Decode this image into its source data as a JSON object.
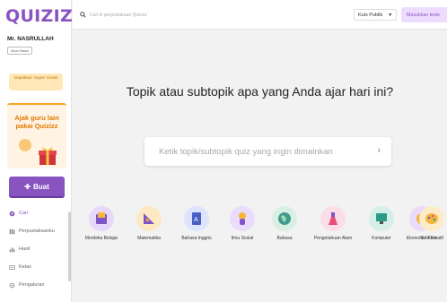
{
  "brand": {
    "logo": "QUIZIZZ"
  },
  "user": {
    "name": "Mr. NASRULLAH",
    "account_badge": "Akun Basic"
  },
  "sidebar": {
    "super_button": "Dapatkan Super Gratis",
    "promo_text": "Ajak guru lain pakai Quizizz",
    "create_label": "Buat",
    "nav": [
      {
        "label": "Cari",
        "icon": "compass-icon"
      },
      {
        "label": "Perpustakaanku",
        "icon": "library-icon"
      },
      {
        "label": "Hasil",
        "icon": "chart-icon"
      },
      {
        "label": "Kelas",
        "icon": "class-icon"
      },
      {
        "label": "Pengaturan",
        "icon": "gear-icon"
      }
    ]
  },
  "topbar": {
    "search_placeholder": "Cari di perpustakaan Quizizz",
    "filter_value": "Kuis Publik",
    "join_label": "Masukkan kode"
  },
  "main": {
    "headline": "Topik atau subtopik apa yang Anda ajar hari ini?",
    "topic_placeholder": "Ketik topik/subtopik quiz yang ingin dimainkan",
    "subjects": [
      {
        "label": "Merdeka Belajar",
        "color": "#f3e5ff"
      },
      {
        "label": "Matematika",
        "color": "#fff0d6"
      },
      {
        "label": "Bahasa Inggris",
        "color": "#e6ecff"
      },
      {
        "label": "Ilmu Sosial",
        "color": "#efe4ff"
      },
      {
        "label": "Bahasa",
        "color": "#e0f3ea"
      },
      {
        "label": "Pengetahuan Alam",
        "color": "#ffe4ee"
      },
      {
        "label": "Komputer",
        "color": "#e0f5f0"
      },
      {
        "label": "Ekonomi / Karir",
        "color": "#f3e5ff"
      },
      {
        "label": "Seni Kreatif",
        "color": "#fff3d9"
      }
    ]
  },
  "colors": {
    "brand": "#8854c0",
    "accent_orange": "#f5a623",
    "bg": "#f2f2f2"
  }
}
